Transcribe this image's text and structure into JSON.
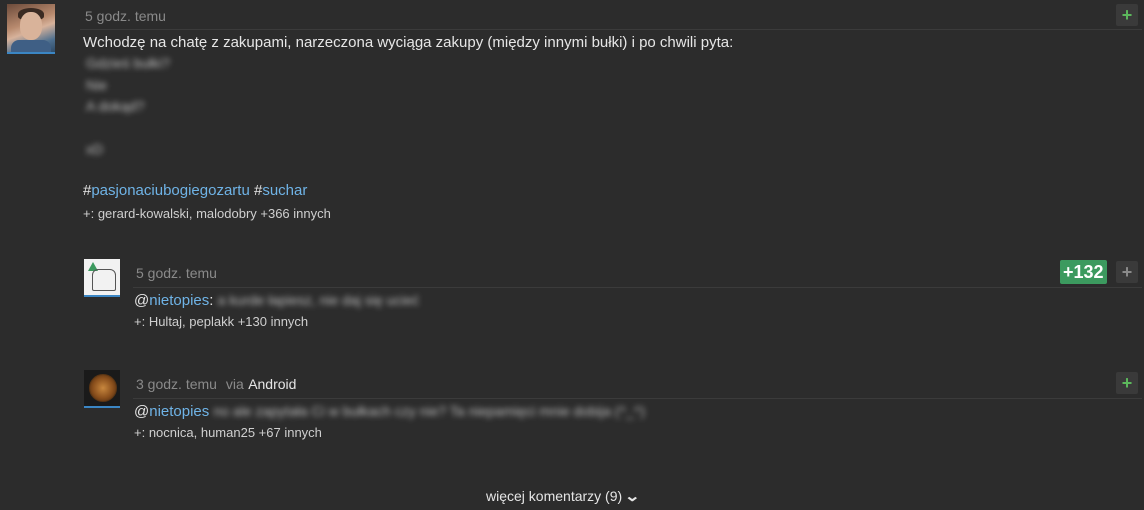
{
  "post": {
    "timestamp": "5 godz. temu",
    "text": "Wchodzę na chatę z zakupami, narzeczona wyciąga zakupy (między innymi bułki) i po chwili pyta:",
    "blurred_lines": [
      "Gdzieś bułki?",
      "Nie",
      "A dokąd?",
      "xD"
    ],
    "tags": [
      {
        "hash": "#",
        "name": "pasjonaciubogiegozartu"
      },
      {
        "hash": "#",
        "name": "suchar"
      }
    ],
    "voters": "+: gerard-kowalski, malodobry +366 innych",
    "plus_symbol": "+"
  },
  "comments": [
    {
      "timestamp": "5 godz. temu",
      "via": "",
      "via_app": "",
      "mention_at": "@",
      "mention": "nietopies",
      "colon": ":",
      "blurred_text": "a kurde łapiesz, nie daj się ucieć",
      "voters": "+: Hultaj, peplakk +130 innych",
      "votes": "+132",
      "plus_symbol": "+"
    },
    {
      "timestamp": "3 godz. temu",
      "via": "via",
      "via_app": "Android",
      "mention_at": "@",
      "mention": "nietopies",
      "colon": "",
      "blurred_text": "no ale zapytała Ci w bułkach czy nie? Ta niepamięci mnie dobija (^_^)",
      "voters": "+: nocnica, human25 +67 innych",
      "votes": "",
      "plus_symbol": "+"
    }
  ],
  "more_comments": {
    "label": "więcej komentarzy (9)",
    "icon": "chevron-down-icon"
  },
  "colors": {
    "background": "#2c2c2c",
    "link": "#6fb3e6",
    "vote_green": "#3c9a5f"
  }
}
